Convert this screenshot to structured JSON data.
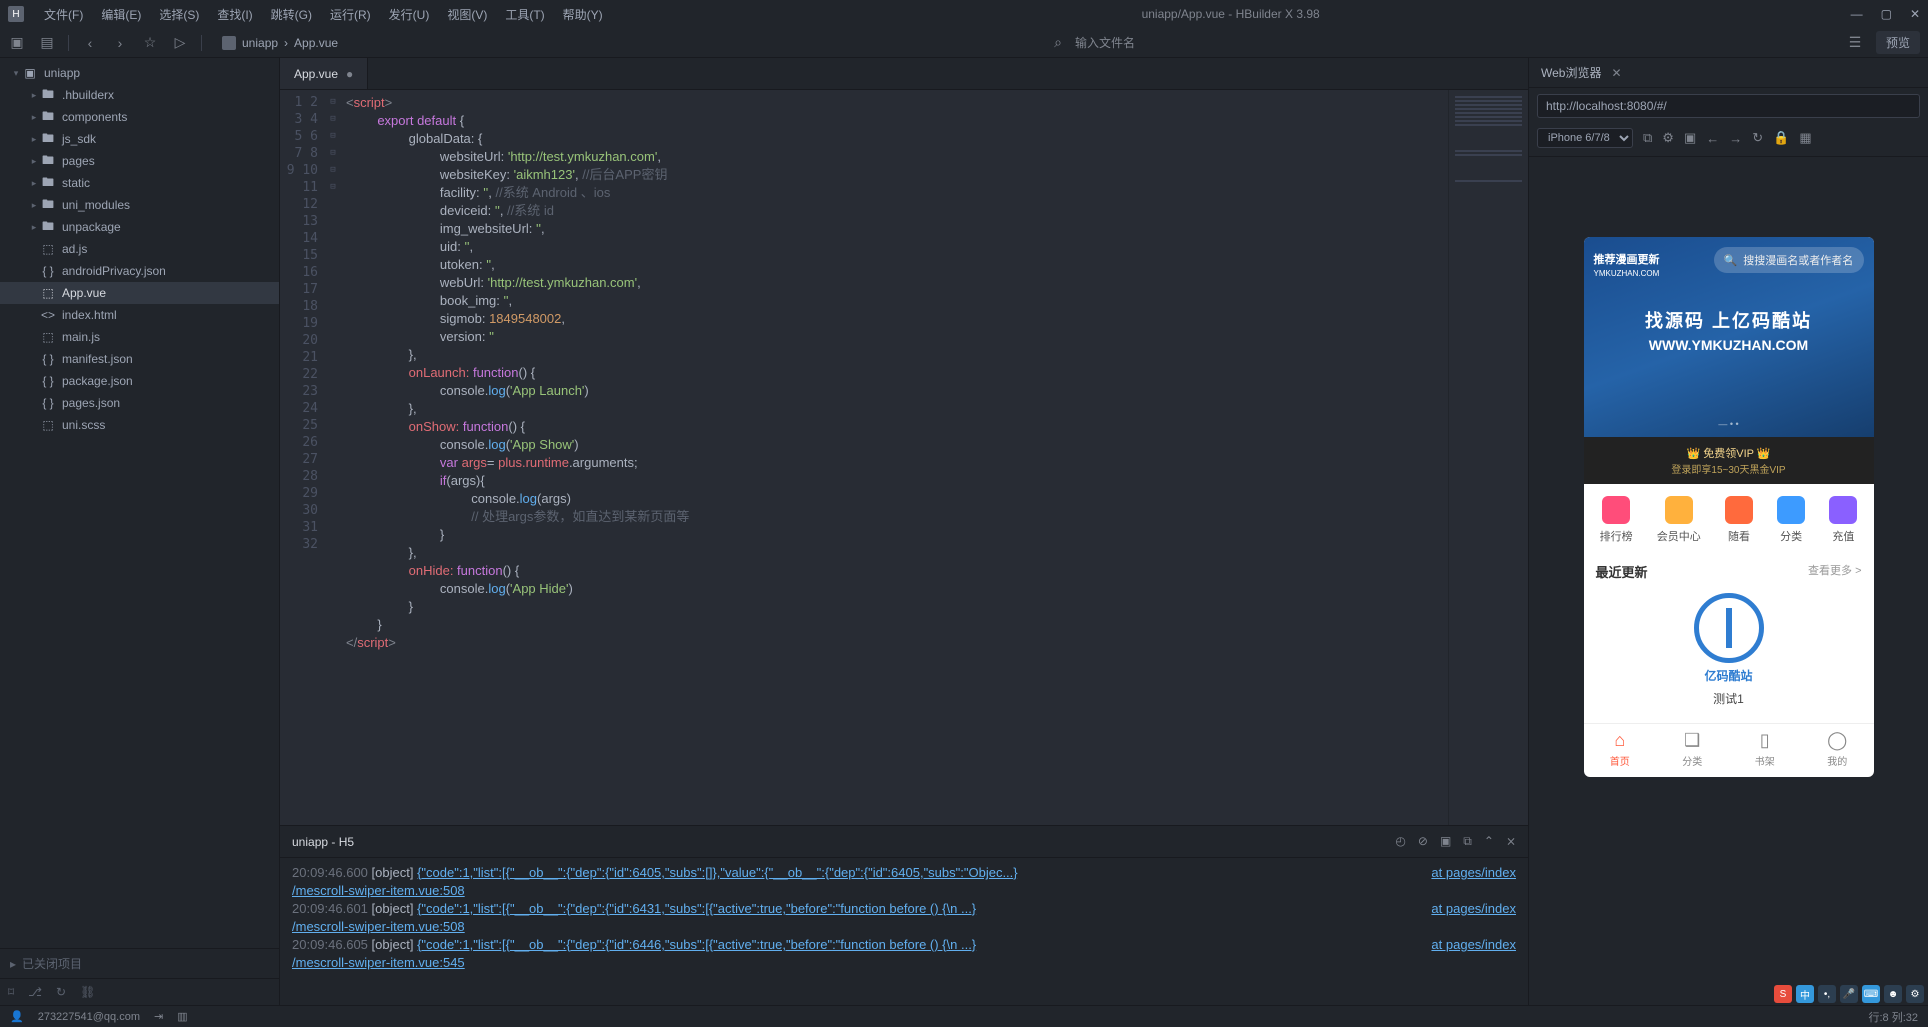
{
  "title": "uniapp/App.vue - HBuilder X 3.98",
  "menus": [
    "文件(F)",
    "编辑(E)",
    "选择(S)",
    "查找(I)",
    "跳转(G)",
    "运行(R)",
    "发行(U)",
    "视图(V)",
    "工具(T)",
    "帮助(Y)"
  ],
  "breadcrumb": {
    "project": "uniapp",
    "file": "App.vue"
  },
  "search_placeholder": "输入文件名",
  "preview_btn": "预览",
  "tree": {
    "root": "uniapp",
    "folders": [
      ".hbuilderx",
      "components",
      "js_sdk",
      "pages",
      "static",
      "uni_modules",
      "unpackage"
    ],
    "files": [
      "ad.js",
      "androidPrivacy.json",
      "App.vue",
      "index.html",
      "main.js",
      "manifest.json",
      "package.json",
      "pages.json",
      "uni.scss"
    ],
    "active": "App.vue"
  },
  "closed_projects": "已关闭项目",
  "tab_name": "App.vue",
  "code": {
    "l1": {
      "a": "<",
      "b": "script",
      "c": ">"
    },
    "l2": {
      "a": "export ",
      "b": "default",
      " c": " {"
    },
    "l3": "globalData: {",
    "l4": {
      "a": "websiteUrl: ",
      "b": "'http://test.ymkuzhan.com'",
      "c": ","
    },
    "l5": {
      "a": "websiteKey: ",
      "b": "'aikmh123'",
      "c": ", ",
      "d": "//后台APP密钥"
    },
    "l6": {
      "a": "facility: ",
      "b": "''",
      "c": ", ",
      "d": "//系统 Android 、ios"
    },
    "l7": {
      "a": "deviceid: ",
      "b": "''",
      "c": ", ",
      "d": "//系统 id"
    },
    "l8": {
      "a": "img_websiteUrl: ",
      "b": "''",
      "c": ","
    },
    "l9": {
      "a": "uid: ",
      "b": "''",
      "c": ","
    },
    "l10": {
      "a": "utoken: ",
      "b": "''",
      "c": ","
    },
    "l11": {
      "a": "webUrl: ",
      "b": "'http://test.ymkuzhan.com'",
      "c": ","
    },
    "l12": {
      "a": "book_img: ",
      "b": "''",
      "c": ","
    },
    "l13": {
      "a": "sigmob: ",
      "b": "1849548002",
      "c": ","
    },
    "l14": {
      "a": "version: ",
      "b": "''"
    },
    "l15": "},",
    "l16": {
      "a": "onLaunch: ",
      "b": "function",
      "c": "() {"
    },
    "l17": {
      "a": "console.",
      "b": "log",
      "c": "(",
      "d": "'App Launch'",
      "e": ")"
    },
    "l18": "},",
    "l19": {
      "a": "onShow: ",
      "b": "function",
      "c": "() {"
    },
    "l20": {
      "a": "console.",
      "b": "log",
      "c": "(",
      "d": "'App Show'",
      "e": ")"
    },
    "l21": {
      "a": "var ",
      "b": "args",
      "c": "= ",
      "d": "plus",
      ".": "",
      ".r": ".runtime",
      ".a": ".arguments",
      "e": ";"
    },
    "l22": {
      "a": "if",
      "b": "(args){"
    },
    "l23": {
      "a": "console.",
      "b": "log",
      "c": "(args)"
    },
    "l24": "// 处理args参数，如直达到某新页面等",
    "l25": "}",
    "l26": "},",
    "l27": {
      "a": "onHide: ",
      "b": "function",
      "c": "() {"
    },
    "l28": {
      "a": "console.",
      "b": "log",
      "c": "(",
      "d": "'App Hide'",
      "e": ")"
    },
    "l29": "}",
    "l30": "}",
    "l31": {
      "a": "</",
      "b": "script",
      "c": ">"
    }
  },
  "console": {
    "tab": "uniapp - H5",
    "rows": [
      {
        "ts": "20:09:46.600",
        "obj": "[object]",
        "body": "{\"code\":1,\"list\":[{\"__ob__\":{\"dep\":{\"id\":6405,\"subs\":[]},\"value\":{\"__ob__\":{\"dep\":{\"id\":6405,\"subs\":\"Objec...}",
        "at": "at pages/index",
        "file": "/mescroll-swiper-item.vue:508"
      },
      {
        "ts": "20:09:46.601",
        "obj": "[object]",
        "body": "{\"code\":1,\"list\":[{\"__ob__\":{\"dep\":{\"id\":6431,\"subs\":[{\"active\":true,\"before\":\"function before () {\\n    ...}",
        "at": "at pages/index",
        "file": "/mescroll-swiper-item.vue:508"
      },
      {
        "ts": "20:09:46.605",
        "obj": "[object]",
        "body": "{\"code\":1,\"list\":[{\"__ob__\":{\"dep\":{\"id\":6446,\"subs\":[{\"active\":true,\"before\":\"function before () {\\n    ...}",
        "at": "at pages/index",
        "file": "/mescroll-swiper-item.vue:545"
      }
    ]
  },
  "browser": {
    "tab": "Web浏览器",
    "url": "http://localhost:8080/#/",
    "device": "iPhone 6/7/8"
  },
  "phone": {
    "brand_top": "推荐漫画更新",
    "brand_sub": "YMKUZHAN.COM",
    "search_ph": "搜搜漫画名或者作者名",
    "hero_line1": "找源码 上亿码酷站",
    "hero_line2": "WWW.YMKUZHAN.COM",
    "vip": "免费领VIP",
    "vip_sub": "登录即享15~30天黑金VIP",
    "grid": [
      "排行榜",
      "会员中心",
      "随看",
      "分类",
      "充值"
    ],
    "grid_colors": [
      "#ff4d7a",
      "#ffb13d",
      "#ff6a3d",
      "#3d9bff",
      "#8a60ff"
    ],
    "section": "最近更新",
    "more": "查看更多 >",
    "logo_text": "亿码酷站",
    "item": "测试1",
    "tabs": [
      "首页",
      "分类",
      "书架",
      "我的"
    ]
  },
  "status": {
    "email": "273227541@qq.com",
    "cursor": "行:8  列:32"
  }
}
